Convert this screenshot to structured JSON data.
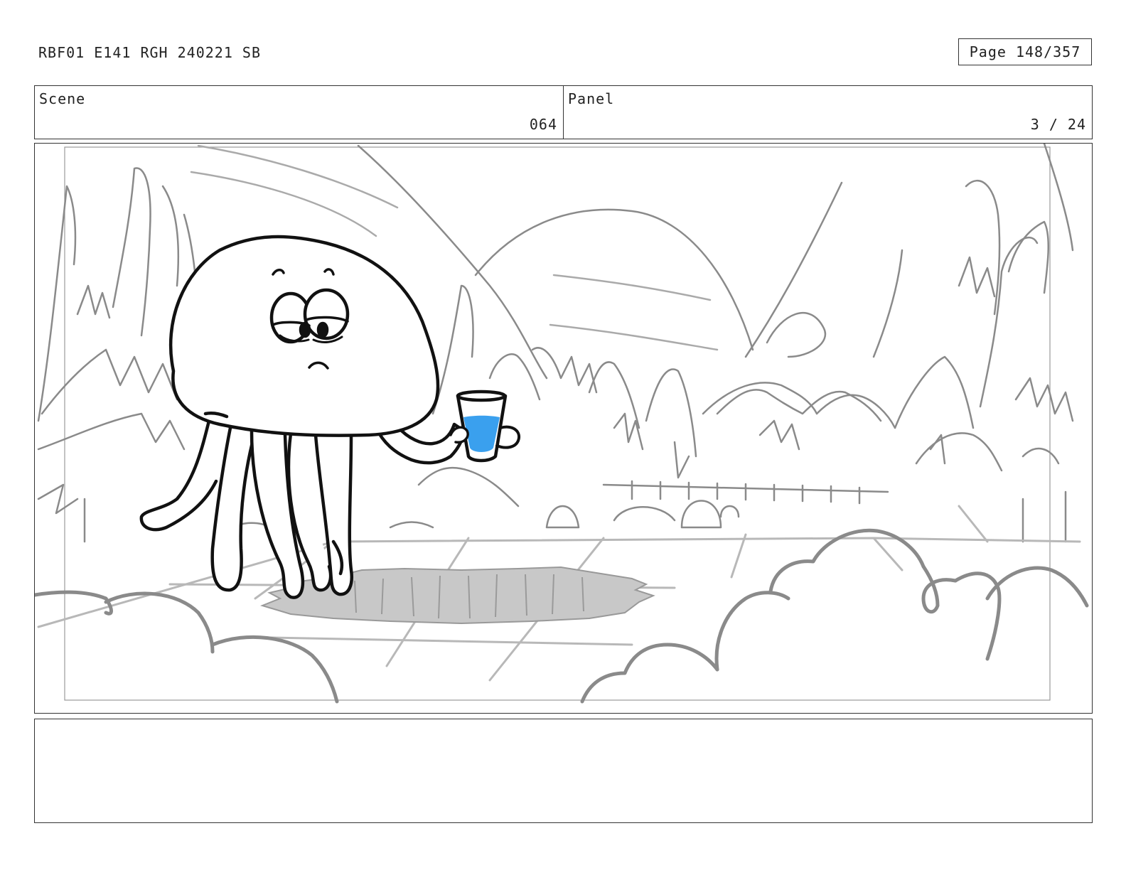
{
  "header": {
    "doc_id": "RBF01 E141 RGH 240221 SB",
    "page": "Page 148/357"
  },
  "info": {
    "scene_label": "Scene",
    "scene_value": "064",
    "panel_label": "Panel",
    "panel_value": "3 / 24"
  },
  "drawing": {
    "subject": "jellyfish",
    "held_object": "water-glass-icon",
    "colors": {
      "ink": "#111111",
      "background_sketch": "#8a8a8a",
      "light_sketch": "#b5b5b5",
      "water": "#3aa0ee",
      "hole_shadow": "#c8c8c8"
    }
  },
  "notes": {
    "text": ""
  }
}
